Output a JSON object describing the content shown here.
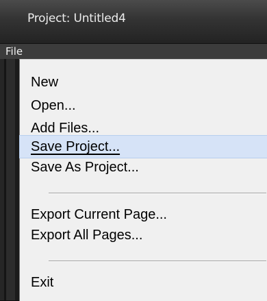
{
  "window": {
    "title": "Project: Untitled4"
  },
  "menubar": {
    "file_label": "File"
  },
  "file_menu": {
    "new_label": "New",
    "open_label": "Open...",
    "add_files_label": "Add Files...",
    "save_project_label": "Save Project...",
    "save_as_project_label": "Save As Project...",
    "export_current_page_label": "Export Current Page...",
    "export_all_pages_label": "Export All Pages...",
    "exit_label": "Exit",
    "highlighted_item": "Save Project..."
  },
  "colors": {
    "highlight": "#d6e3f7",
    "menu_background": "#f0f0f0",
    "titlebar": "#333333"
  }
}
